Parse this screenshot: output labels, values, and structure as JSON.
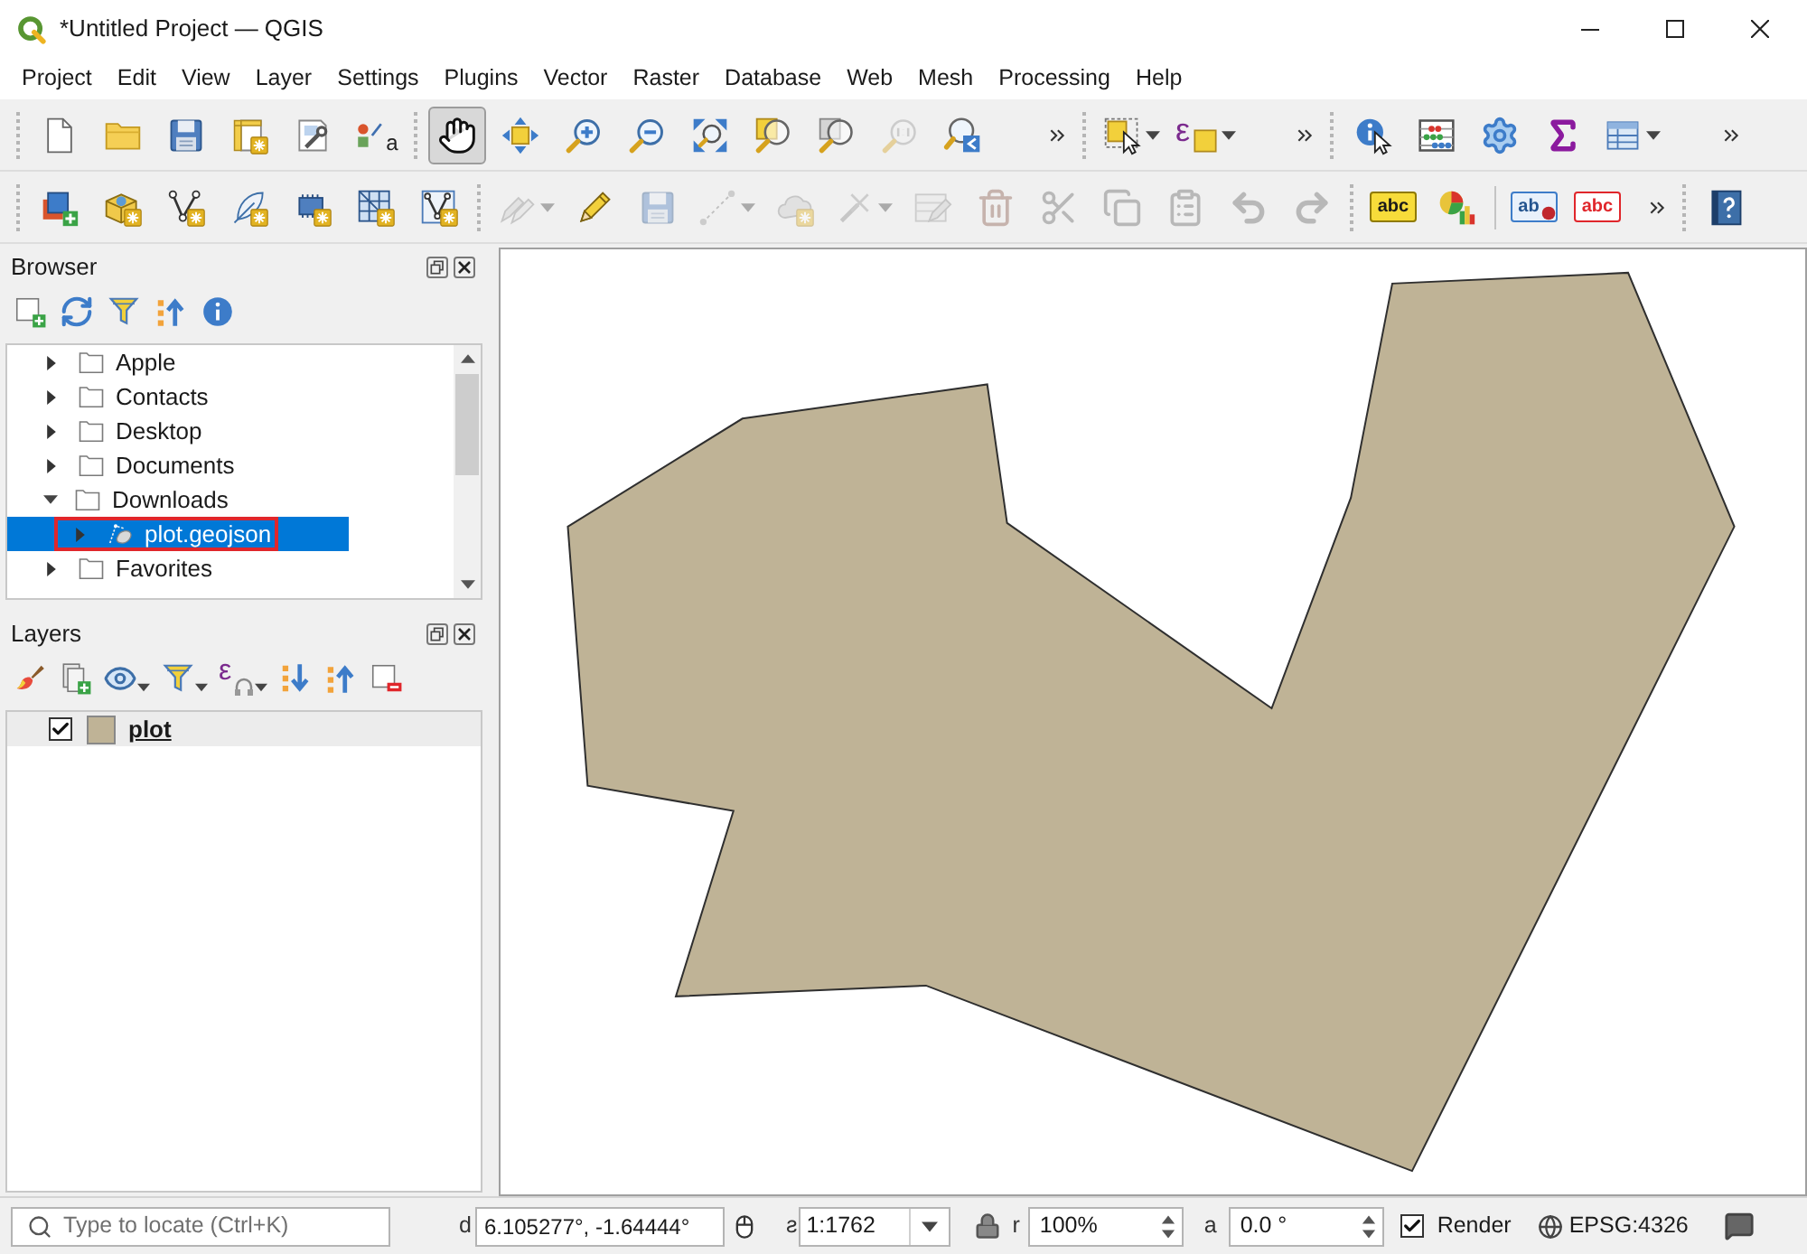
{
  "window": {
    "title": "*Untitled Project — QGIS"
  },
  "menu": [
    "Project",
    "Edit",
    "View",
    "Layer",
    "Settings",
    "Plugins",
    "Vector",
    "Raster",
    "Database",
    "Web",
    "Mesh",
    "Processing",
    "Help"
  ],
  "toolbars": [
    {
      "groups": [
        {
          "items": [
            {
              "kind": "new",
              "selected": false,
              "disabled": false
            },
            {
              "kind": "open",
              "selected": false,
              "disabled": false
            },
            {
              "kind": "save",
              "selected": false,
              "disabled": false
            },
            {
              "kind": "newlayout",
              "selected": false,
              "disabled": false
            },
            {
              "kind": "layouts",
              "selected": false,
              "disabled": false
            },
            {
              "kind": "styles",
              "glyph": "a",
              "selected": false,
              "disabled": false
            }
          ]
        },
        {
          "overflow": true,
          "items": [
            {
              "kind": "pan",
              "selected": true,
              "disabled": false
            },
            {
              "kind": "pantoselection",
              "selected": false,
              "disabled": false
            },
            {
              "kind": "zoomin",
              "selected": false,
              "disabled": false
            },
            {
              "kind": "zoomout",
              "selected": false,
              "disabled": false
            },
            {
              "kind": "zoomfull",
              "selected": false,
              "disabled": false
            },
            {
              "kind": "zoomselection",
              "selected": false,
              "disabled": false
            },
            {
              "kind": "zoomlayer",
              "selected": false,
              "disabled": false
            },
            {
              "kind": "zoomnative",
              "selected": false,
              "disabled": true
            },
            {
              "kind": "zoomlast",
              "selected": false,
              "disabled": false
            }
          ]
        },
        {
          "overflow": true,
          "items": [
            {
              "kind": "select",
              "dropdown": true,
              "selected": false,
              "disabled": false
            },
            {
              "kind": "selectexpression",
              "glyph": "ε",
              "dropdown": true,
              "selected": false,
              "disabled": false
            }
          ]
        },
        {
          "overflow": true,
          "items": [
            {
              "kind": "identify",
              "selected": false,
              "disabled": false
            },
            {
              "kind": "fieldcalc",
              "selected": false,
              "disabled": false
            },
            {
              "kind": "toolbox",
              "selected": false,
              "disabled": false
            },
            {
              "kind": "statistics",
              "selected": false,
              "disabled": false
            },
            {
              "kind": "attributes",
              "dropdown": true,
              "selected": false,
              "disabled": false
            }
          ]
        }
      ]
    },
    {
      "groups": [
        {
          "items": [
            {
              "kind": "datasource",
              "selected": false,
              "disabled": false
            },
            {
              "kind": "newgeopackage",
              "selected": false,
              "disabled": false
            },
            {
              "kind": "newshapefile",
              "selected": false,
              "disabled": false
            },
            {
              "kind": "newspatialite",
              "selected": false,
              "disabled": false
            },
            {
              "kind": "newscratch",
              "selected": false,
              "disabled": false
            },
            {
              "kind": "newmesh",
              "selected": false,
              "disabled": false
            },
            {
              "kind": "newvirtual",
              "selected": false,
              "disabled": false
            }
          ]
        },
        {
          "items": [
            {
              "kind": "edits",
              "dropdown": true,
              "selected": false,
              "disabled": true
            },
            {
              "kind": "toggleedit",
              "selected": false,
              "disabled": false
            },
            {
              "kind": "saveedits",
              "selected": false,
              "disabled": true
            },
            {
              "kind": "addline",
              "dropdown": true,
              "selected": false,
              "disabled": true
            },
            {
              "kind": "addpart",
              "selected": false,
              "disabled": true
            },
            {
              "kind": "vertextool",
              "dropdown": true,
              "selected": false,
              "disabled": true
            },
            {
              "kind": "editattributes",
              "selected": false,
              "disabled": true
            },
            {
              "kind": "delete",
              "selected": false,
              "disabled": true
            },
            {
              "kind": "cut",
              "selected": false,
              "disabled": true
            },
            {
              "kind": "copy",
              "selected": false,
              "disabled": true
            },
            {
              "kind": "paste",
              "selected": false,
              "disabled": true
            },
            {
              "kind": "undo",
              "selected": false,
              "disabled": true
            },
            {
              "kind": "redo",
              "selected": false,
              "disabled": true
            }
          ]
        },
        {
          "overflow": true,
          "items": [
            {
              "kind": "label",
              "glyph": "abc",
              "selected": false,
              "disabled": false
            },
            {
              "kind": "diagram",
              "selected": false,
              "disabled": false
            },
            {
              "kind": "pinlabel",
              "glyph": "ab",
              "divider": true,
              "selected": false,
              "disabled": false
            },
            {
              "kind": "hidelabel",
              "glyph": "abc",
              "selected": false,
              "disabled": false
            }
          ]
        },
        {
          "items": [
            {
              "kind": "help",
              "selected": false,
              "disabled": false
            }
          ]
        }
      ]
    }
  ],
  "browser": {
    "title": "Browser",
    "tools": [
      {
        "kind": "addlayer"
      },
      {
        "kind": "refresh"
      },
      {
        "kind": "filter"
      },
      {
        "kind": "collapse"
      },
      {
        "kind": "properties"
      }
    ],
    "tree": [
      {
        "kind": "folder",
        "label": "Apple",
        "expanded": false,
        "selected": false,
        "highlighted": false
      },
      {
        "kind": "folder",
        "label": "Contacts",
        "expanded": false,
        "selected": false,
        "highlighted": false
      },
      {
        "kind": "folder",
        "label": "Desktop",
        "expanded": false,
        "selected": false,
        "highlighted": false
      },
      {
        "kind": "folder",
        "label": "Documents",
        "expanded": false,
        "selected": false,
        "highlighted": false
      },
      {
        "kind": "folder",
        "label": "Downloads",
        "expanded": true,
        "selected": false,
        "highlighted": false,
        "children": [
          {
            "kind": "vector",
            "label": "plot.geojson",
            "expanded": false,
            "selected": true,
            "highlighted": true
          }
        ]
      },
      {
        "kind": "folder",
        "label": "Favorites",
        "expanded": false,
        "selected": false,
        "highlighted": false
      }
    ]
  },
  "layers": {
    "title": "Layers",
    "tools": [
      {
        "kind": "style"
      },
      {
        "kind": "addgroup"
      },
      {
        "kind": "visibility",
        "dropdown": true
      },
      {
        "kind": "filter",
        "dropdown": true
      },
      {
        "kind": "filterexpression",
        "glyph": "ε",
        "dropdown": true
      },
      {
        "kind": "expandall"
      },
      {
        "kind": "collapseall"
      },
      {
        "kind": "remove"
      }
    ],
    "items": [
      {
        "name": "plot",
        "checked": true,
        "selected": true,
        "color": "#bfb396"
      }
    ]
  },
  "status_bar": {
    "locator": {
      "placeholder": "Type to locate (Ctrl+K)"
    },
    "coordinate": {
      "label": "d",
      "value": "6.105277°, -1.64444°"
    },
    "scale": {
      "label": "ƨ",
      "value": "1:1762"
    },
    "magnifier": {
      "label": "r",
      "value": "100%"
    },
    "rotation": {
      "label": "a",
      "value": "0.0 °"
    },
    "render": {
      "label": "Render",
      "checked": true
    },
    "crs": "EPSG:4326"
  }
}
